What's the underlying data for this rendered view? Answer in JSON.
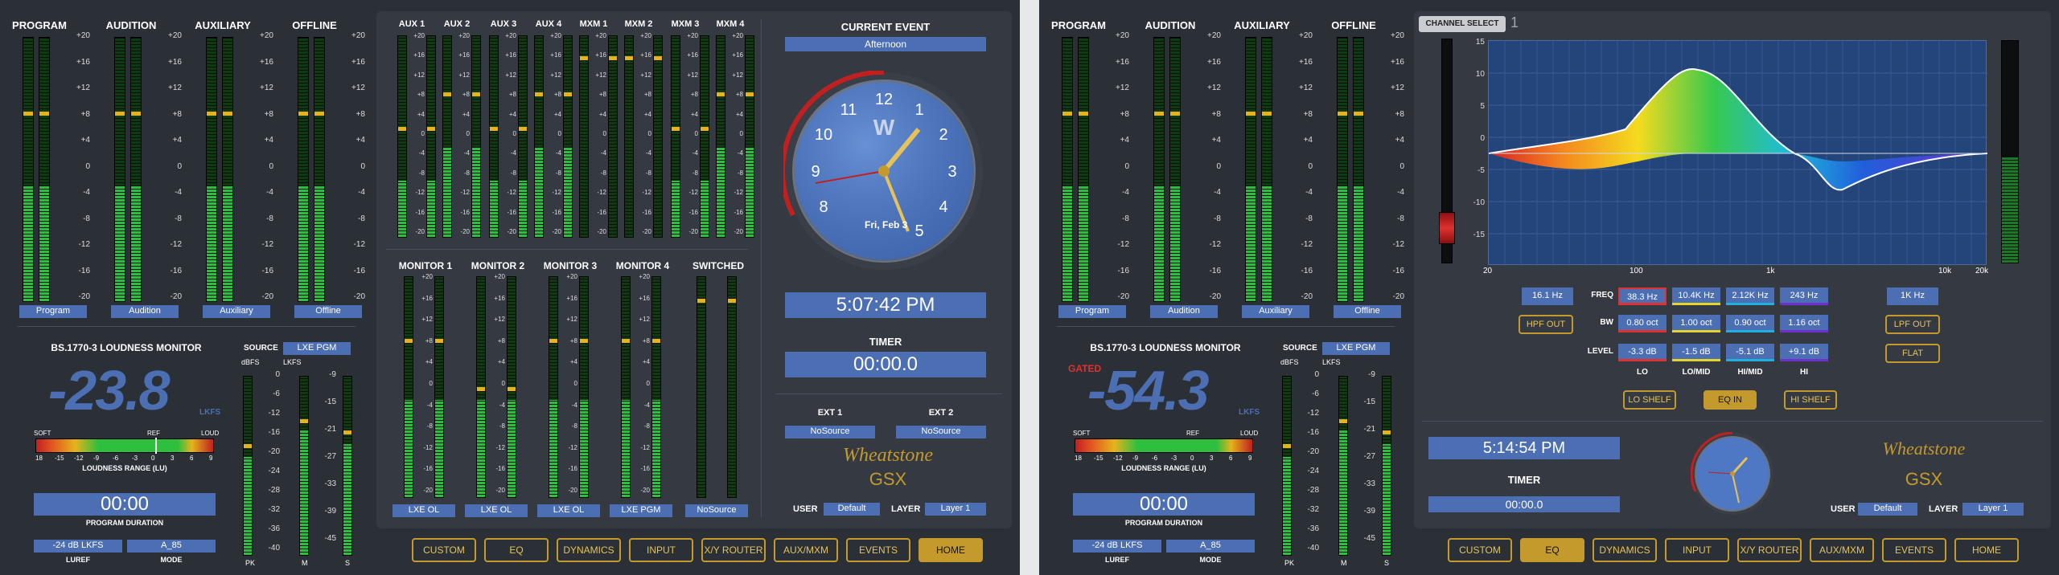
{
  "colors": {
    "accent": "#4c6eb3",
    "gold": "#c49a2c",
    "green": "#2fbf3f",
    "yellow": "#e5b31b",
    "red": "#e03030"
  },
  "left": {
    "meters": {
      "labels": [
        "PROGRAM",
        "AUDITION",
        "AUXILIARY",
        "OFFLINE"
      ],
      "chips": [
        "Program",
        "Audition",
        "Auxiliary",
        "Offline"
      ],
      "scale": [
        "+20",
        "+16",
        "+12",
        "+8",
        "+4",
        "0",
        "-4",
        "-8",
        "-12",
        "-16",
        "-20"
      ],
      "levels": [
        0.44,
        0.44,
        0.44,
        0.44
      ]
    },
    "aux_labels": [
      "AUX 1",
      "AUX 2",
      "AUX 3",
      "AUX 4",
      "MXM 1",
      "MXM 2",
      "MXM 3",
      "MXM 4"
    ],
    "aux_scale": [
      "+20",
      "+16",
      "+12",
      "+8",
      "+4",
      "0",
      "-4",
      "-8",
      "-12",
      "-16",
      "-20"
    ],
    "monitor_labels": [
      "MONITOR 1",
      "MONITOR 2",
      "MONITOR 3",
      "MONITOR 4",
      "SWITCHED"
    ],
    "monitor_chips": [
      "LXE OL",
      "LXE OL",
      "LXE OL",
      "LXE PGM",
      "NoSource"
    ],
    "loudness": {
      "title": "BS.1770-3 LOUDNESS MONITOR",
      "source_label": "SOURCE",
      "source": "LXE PGM",
      "value": "-23.8",
      "unit": "LKFS",
      "range_soft": "SOFT",
      "range_ref": "REF",
      "range_loud": "LOUD",
      "range_ticks": [
        "18",
        "-15",
        "-12",
        "-9",
        "-6",
        "-3",
        "0",
        "3",
        "6",
        "9"
      ],
      "range_label": "LOUDNESS RANGE (LU)",
      "duration": "00:00",
      "duration_label": "PROGRAM DURATION",
      "luref": "-24 dB LKFS",
      "luref_label": "LUREF",
      "mode": "A_85",
      "mode_label": "MODE",
      "dbfs": "dBFS",
      "lkfs": "LKFS",
      "dbfs_scale": [
        "0",
        "-6",
        "-12",
        "-16",
        "-20",
        "-24",
        "-28",
        "-32",
        "-36",
        "-40"
      ],
      "lkfs_scale": [
        "-9",
        "-15",
        "-21",
        "-27",
        "-33",
        "-39",
        "-45"
      ],
      "pk": "PK",
      "m": "M",
      "s": "S"
    },
    "event": {
      "label": "CURRENT EVENT",
      "name": "Afternoon",
      "time": "5:07:42 PM",
      "timer_label": "TIMER",
      "timer": "00:00.0",
      "ext1": "EXT 1",
      "ext2": "EXT 2",
      "ext1_val": "NoSource",
      "ext2_val": "NoSource",
      "user_label": "USER",
      "user": "Default",
      "layer_label": "LAYER",
      "layer": "Layer 1",
      "clock_date": "Fri, Feb 3",
      "brand": "Wheatstone",
      "model": "GSX"
    },
    "nav": [
      "CUSTOM",
      "EQ",
      "DYNAMICS",
      "INPUT",
      "X/Y ROUTER",
      "AUX/MXM",
      "EVENTS",
      "HOME"
    ]
  },
  "right": {
    "meters": {
      "labels": [
        "PROGRAM",
        "AUDITION",
        "AUXILIARY",
        "OFFLINE"
      ],
      "chips": [
        "Program",
        "Audition",
        "Auxiliary",
        "Offline"
      ],
      "scale": [
        "+20",
        "+16",
        "+12",
        "+8",
        "+4",
        "0",
        "-4",
        "-8",
        "-12",
        "-16",
        "-20"
      ]
    },
    "eq": {
      "channel_select": "CHANNEL SELECT",
      "channel": "1",
      "y_ticks": [
        "15",
        "10",
        "5",
        "0",
        "-5",
        "-10",
        "-15"
      ],
      "x_ticks": [
        "20",
        "100",
        "1k",
        "10k",
        "20k"
      ],
      "hpf_freq": "16.1 Hz",
      "freq_label": "FREQ",
      "bw_label": "BW",
      "level_label": "LEVEL",
      "hpf_out": "HPF OUT",
      "lpf_freq": "1K Hz",
      "lpf_out": "LPF OUT",
      "flat": "FLAT",
      "bands": [
        {
          "name": "LO",
          "freq": "38.3 Hz",
          "bw": "0.80 oct",
          "level": "-3.3 dB"
        },
        {
          "name": "LO/MID",
          "freq": "10.4K Hz",
          "bw": "1.00 oct",
          "level": "-1.5 dB"
        },
        {
          "name": "HI/MID",
          "freq": "2.12K Hz",
          "bw": "0.90 oct",
          "level": "-5.1 dB"
        },
        {
          "name": "HI",
          "freq": "243 Hz",
          "bw": "1.16 oct",
          "level": "+9.1 dB"
        }
      ],
      "lo_shelf": "LO SHELF",
      "eq_in": "EQ IN",
      "hi_shelf": "HI SHELF"
    },
    "loudness": {
      "title": "BS.1770-3 LOUDNESS MONITOR",
      "gated": "GATED",
      "source_label": "SOURCE",
      "source": "LXE PGM",
      "value": "-54.3",
      "unit": "LKFS",
      "duration": "00:00",
      "duration_label": "PROGRAM DURATION",
      "luref": "-24 dB LKFS",
      "luref_label": "LUREF",
      "mode": "A_85",
      "mode_label": "MODE"
    },
    "event": {
      "time": "5:14:54 PM",
      "timer_label": "TIMER",
      "timer": "00:00.0",
      "user_label": "USER",
      "user": "Default",
      "layer_label": "LAYER",
      "layer": "Layer 1",
      "brand": "Wheatstone",
      "model": "GSX"
    },
    "nav": [
      "CUSTOM",
      "EQ",
      "DYNAMICS",
      "INPUT",
      "X/Y ROUTER",
      "AUX/MXM",
      "EVENTS",
      "HOME"
    ]
  }
}
